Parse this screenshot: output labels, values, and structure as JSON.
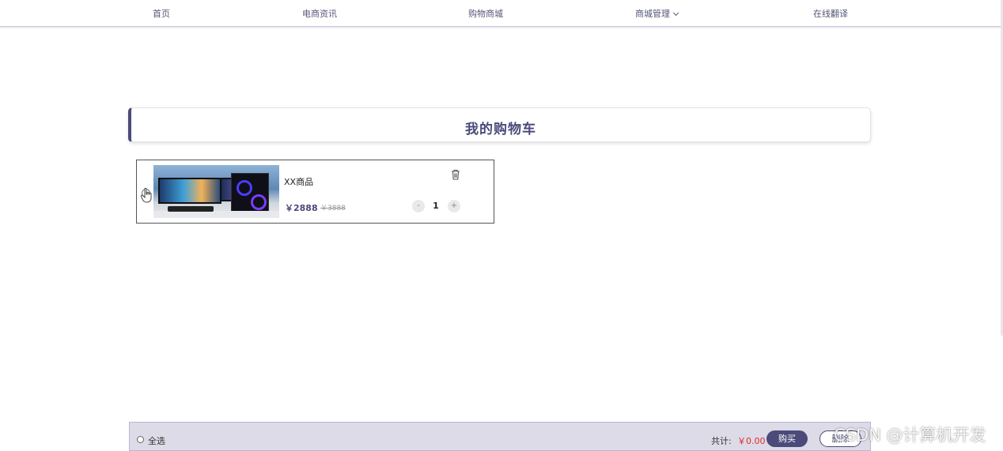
{
  "nav": {
    "items": [
      {
        "label": "首页"
      },
      {
        "label": "电商资讯"
      },
      {
        "label": "购物商城"
      },
      {
        "label": "商城管理",
        "has_dropdown": true
      },
      {
        "label": "在线翻译"
      }
    ]
  },
  "page": {
    "title": "我的购物车"
  },
  "cart": {
    "items": [
      {
        "name": "XX商品",
        "price": "￥2888",
        "original_price": "￥3888",
        "quantity": "1",
        "minus_label": "-",
        "plus_label": "+",
        "selected": false
      }
    ]
  },
  "footer": {
    "select_all_label": "全选",
    "total_label": "共计:",
    "total_amount": "￥0.00",
    "buy_label": "购买",
    "delete_label": "删除"
  },
  "watermark": "CSDN @计算机开发",
  "colors": {
    "accent": "#4b4a7a",
    "price_red": "#e02b2b",
    "footer_bg": "#dcdbe7"
  },
  "icons": [
    "chevron-down-icon",
    "hand-pointer-icon",
    "trash-icon"
  ]
}
